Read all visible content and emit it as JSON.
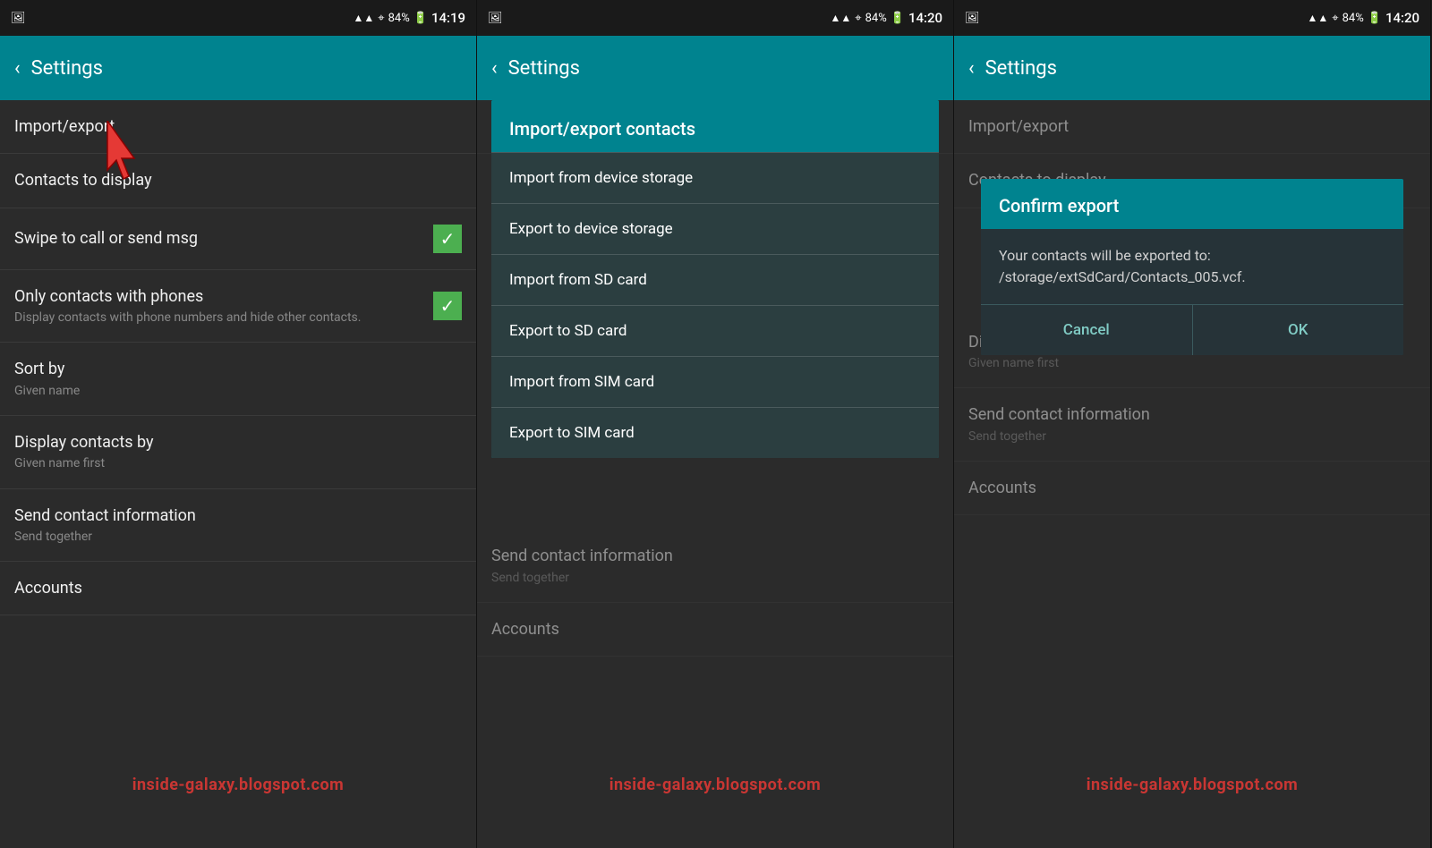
{
  "panel1": {
    "statusbar": {
      "left_icon": "🖼",
      "signal": "▲▲",
      "wifi": "WiFi",
      "battery_pct": "84%",
      "battery_icon": "🔋",
      "time": "14:19"
    },
    "appbar": {
      "back_label": "‹",
      "title": "Settings"
    },
    "items": [
      {
        "id": "import-export",
        "title": "Import/export",
        "subtitle": "",
        "has_checkbox": false
      },
      {
        "id": "contacts-display",
        "title": "Contacts to display",
        "subtitle": "",
        "has_checkbox": false
      },
      {
        "id": "swipe-call",
        "title": "Swipe to call or send msg",
        "subtitle": "",
        "has_checkbox": true,
        "checked": true
      },
      {
        "id": "only-phones",
        "title": "Only contacts with phones",
        "subtitle": "Display contacts with phone numbers and hide other contacts.",
        "has_checkbox": true,
        "checked": true
      },
      {
        "id": "sort-by",
        "title": "Sort by",
        "subtitle": "Given name",
        "has_checkbox": false
      },
      {
        "id": "display-by",
        "title": "Display contacts by",
        "subtitle": "Given name first",
        "has_checkbox": false
      },
      {
        "id": "send-info",
        "title": "Send contact information",
        "subtitle": "Send together",
        "has_checkbox": false
      },
      {
        "id": "accounts",
        "title": "Accounts",
        "subtitle": "",
        "has_checkbox": false
      }
    ],
    "watermark": "inside-galaxy.blogspot.com",
    "cursor_present": true
  },
  "panel2": {
    "statusbar": {
      "time": "14:20"
    },
    "appbar": {
      "back_label": "‹",
      "title": "Settings"
    },
    "section": "Import/export",
    "dialog": {
      "header": "Import/export contacts",
      "items": [
        "Import from device storage",
        "Export to device storage",
        "Import from SD card",
        "Export to SD card",
        "Import from SIM card",
        "Export to SIM card"
      ]
    },
    "below_items": [
      {
        "id": "send-info2",
        "title": "Send contact information",
        "subtitle": "Send together"
      },
      {
        "id": "accounts2",
        "title": "Accounts",
        "subtitle": ""
      }
    ],
    "watermark": "inside-galaxy.blogspot.com",
    "cursor_present": true
  },
  "panel3": {
    "statusbar": {
      "time": "14:20"
    },
    "appbar": {
      "back_label": "‹",
      "title": "Settings"
    },
    "section": "Import/export",
    "confirm_dialog": {
      "title": "Confirm export",
      "body": "Your contacts will be exported to: /storage/extSdCard/Contacts_005.vcf.",
      "cancel_label": "Cancel",
      "ok_label": "OK"
    },
    "items": [
      {
        "id": "contacts-display3",
        "title": "Contacts to display",
        "subtitle": ""
      },
      {
        "id": "display-by3",
        "title": "Display contacts by",
        "subtitle": "Given name first"
      },
      {
        "id": "send-info3",
        "title": "Send contact information",
        "subtitle": "Send together"
      },
      {
        "id": "accounts3",
        "title": "Accounts",
        "subtitle": ""
      }
    ],
    "watermark": "inside-galaxy.blogspot.com",
    "cursor_present": true
  }
}
